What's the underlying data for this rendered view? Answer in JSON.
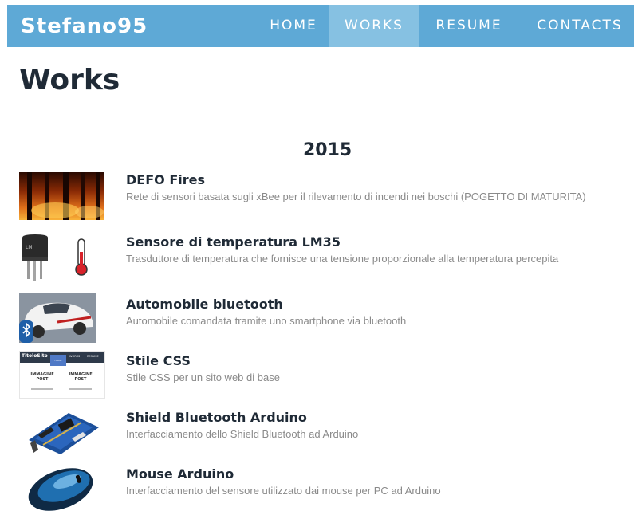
{
  "site": {
    "brand": "Stefano95"
  },
  "nav": {
    "items": [
      {
        "label": "HOME"
      },
      {
        "label": "WORKS"
      },
      {
        "label": "RESUME"
      },
      {
        "label": "CONTACTS"
      }
    ],
    "active": "WORKS"
  },
  "page": {
    "title": "Works"
  },
  "year_section": {
    "year": "2015"
  },
  "works": [
    {
      "title": "DEFO Fires",
      "description": "Rete di sensori basata sugli xBee per il rilevamento di incendi nei boschi (POGETTO DI MATURITA)",
      "image": "forest-fire-image"
    },
    {
      "title": "Sensore di temperatura LM35",
      "description": "Trasduttore di temperatura che fornisce una tensione proporzionale alla temperatura percepita",
      "image": "temperature-sensor-image"
    },
    {
      "title": "Automobile bluetooth",
      "description": "Automobile comandata tramite uno smartphone via bluetooth",
      "image": "bluetooth-car-image"
    },
    {
      "title": "Stile CSS",
      "description": "Stile CSS per un sito web di base",
      "image": "css-layout-image"
    },
    {
      "title": "Shield Bluetooth Arduino",
      "description": "Interfacciamento dello Shield Bluetooth ad Arduino",
      "image": "arduino-shield-image"
    },
    {
      "title": "Mouse Arduino",
      "description": "Interfacciamento del sensore utilizzato dai mouse per PC ad Arduino",
      "image": "computer-mouse-image"
    }
  ],
  "thumb_text": {
    "css": {
      "site_title": "TitoloSito",
      "nav_home": "HOME",
      "nav_works": "WORKS",
      "nav_resume": "RESUME",
      "post_label_line1": "IMMAGINE",
      "post_label_line2": "POST"
    }
  },
  "colors": {
    "navbar": "#5ea9d6",
    "nav_active": "#86c1e2",
    "heading": "#1f2a36",
    "description": "#8a8a8a"
  }
}
